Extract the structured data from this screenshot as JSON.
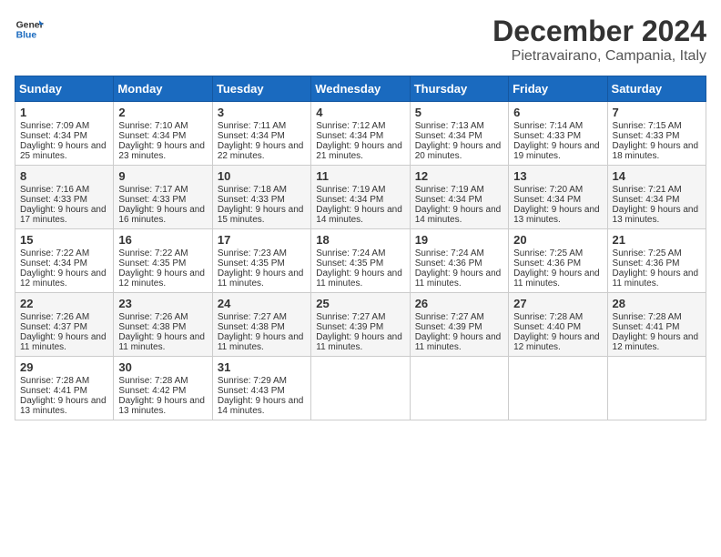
{
  "logo": {
    "text_general": "General",
    "text_blue": "Blue"
  },
  "title": "December 2024",
  "subtitle": "Pietravairano, Campania, Italy",
  "weekdays": [
    "Sunday",
    "Monday",
    "Tuesday",
    "Wednesday",
    "Thursday",
    "Friday",
    "Saturday"
  ],
  "weeks": [
    [
      {
        "day": "1",
        "sunrise": "7:09 AM",
        "sunset": "4:34 PM",
        "daylight": "9 hours and 25 minutes."
      },
      {
        "day": "2",
        "sunrise": "7:10 AM",
        "sunset": "4:34 PM",
        "daylight": "9 hours and 23 minutes."
      },
      {
        "day": "3",
        "sunrise": "7:11 AM",
        "sunset": "4:34 PM",
        "daylight": "9 hours and 22 minutes."
      },
      {
        "day": "4",
        "sunrise": "7:12 AM",
        "sunset": "4:34 PM",
        "daylight": "9 hours and 21 minutes."
      },
      {
        "day": "5",
        "sunrise": "7:13 AM",
        "sunset": "4:34 PM",
        "daylight": "9 hours and 20 minutes."
      },
      {
        "day": "6",
        "sunrise": "7:14 AM",
        "sunset": "4:33 PM",
        "daylight": "9 hours and 19 minutes."
      },
      {
        "day": "7",
        "sunrise": "7:15 AM",
        "sunset": "4:33 PM",
        "daylight": "9 hours and 18 minutes."
      }
    ],
    [
      {
        "day": "8",
        "sunrise": "7:16 AM",
        "sunset": "4:33 PM",
        "daylight": "9 hours and 17 minutes."
      },
      {
        "day": "9",
        "sunrise": "7:17 AM",
        "sunset": "4:33 PM",
        "daylight": "9 hours and 16 minutes."
      },
      {
        "day": "10",
        "sunrise": "7:18 AM",
        "sunset": "4:33 PM",
        "daylight": "9 hours and 15 minutes."
      },
      {
        "day": "11",
        "sunrise": "7:19 AM",
        "sunset": "4:34 PM",
        "daylight": "9 hours and 14 minutes."
      },
      {
        "day": "12",
        "sunrise": "7:19 AM",
        "sunset": "4:34 PM",
        "daylight": "9 hours and 14 minutes."
      },
      {
        "day": "13",
        "sunrise": "7:20 AM",
        "sunset": "4:34 PM",
        "daylight": "9 hours and 13 minutes."
      },
      {
        "day": "14",
        "sunrise": "7:21 AM",
        "sunset": "4:34 PM",
        "daylight": "9 hours and 13 minutes."
      }
    ],
    [
      {
        "day": "15",
        "sunrise": "7:22 AM",
        "sunset": "4:34 PM",
        "daylight": "9 hours and 12 minutes."
      },
      {
        "day": "16",
        "sunrise": "7:22 AM",
        "sunset": "4:35 PM",
        "daylight": "9 hours and 12 minutes."
      },
      {
        "day": "17",
        "sunrise": "7:23 AM",
        "sunset": "4:35 PM",
        "daylight": "9 hours and 11 minutes."
      },
      {
        "day": "18",
        "sunrise": "7:24 AM",
        "sunset": "4:35 PM",
        "daylight": "9 hours and 11 minutes."
      },
      {
        "day": "19",
        "sunrise": "7:24 AM",
        "sunset": "4:36 PM",
        "daylight": "9 hours and 11 minutes."
      },
      {
        "day": "20",
        "sunrise": "7:25 AM",
        "sunset": "4:36 PM",
        "daylight": "9 hours and 11 minutes."
      },
      {
        "day": "21",
        "sunrise": "7:25 AM",
        "sunset": "4:36 PM",
        "daylight": "9 hours and 11 minutes."
      }
    ],
    [
      {
        "day": "22",
        "sunrise": "7:26 AM",
        "sunset": "4:37 PM",
        "daylight": "9 hours and 11 minutes."
      },
      {
        "day": "23",
        "sunrise": "7:26 AM",
        "sunset": "4:38 PM",
        "daylight": "9 hours and 11 minutes."
      },
      {
        "day": "24",
        "sunrise": "7:27 AM",
        "sunset": "4:38 PM",
        "daylight": "9 hours and 11 minutes."
      },
      {
        "day": "25",
        "sunrise": "7:27 AM",
        "sunset": "4:39 PM",
        "daylight": "9 hours and 11 minutes."
      },
      {
        "day": "26",
        "sunrise": "7:27 AM",
        "sunset": "4:39 PM",
        "daylight": "9 hours and 11 minutes."
      },
      {
        "day": "27",
        "sunrise": "7:28 AM",
        "sunset": "4:40 PM",
        "daylight": "9 hours and 12 minutes."
      },
      {
        "day": "28",
        "sunrise": "7:28 AM",
        "sunset": "4:41 PM",
        "daylight": "9 hours and 12 minutes."
      }
    ],
    [
      {
        "day": "29",
        "sunrise": "7:28 AM",
        "sunset": "4:41 PM",
        "daylight": "9 hours and 13 minutes."
      },
      {
        "day": "30",
        "sunrise": "7:28 AM",
        "sunset": "4:42 PM",
        "daylight": "9 hours and 13 minutes."
      },
      {
        "day": "31",
        "sunrise": "7:29 AM",
        "sunset": "4:43 PM",
        "daylight": "9 hours and 14 minutes."
      },
      null,
      null,
      null,
      null
    ]
  ]
}
